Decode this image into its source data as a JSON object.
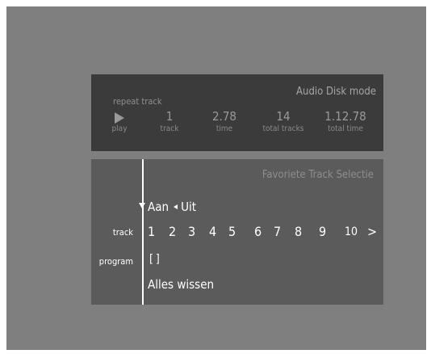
{
  "status": {
    "mode_title": "Audio Disk mode",
    "repeat_label": "repeat track",
    "play_label": "play",
    "stats": [
      {
        "value": "1",
        "label": "track"
      },
      {
        "value": "2.78",
        "label": "time"
      },
      {
        "value": "14",
        "label": "total tracks"
      },
      {
        "value": "1.12.78",
        "label": "total time"
      }
    ]
  },
  "favorites": {
    "title": "Favoriete Track Selectie",
    "toggle_on": "Aan",
    "toggle_off": "Uit",
    "track_label": "track",
    "program_label": "program",
    "tracks": [
      "1",
      "2",
      "3",
      "4",
      "5",
      "6",
      "7",
      "8",
      "9",
      "10"
    ],
    "next_glyph": ">",
    "program_value": "[]",
    "clear_all": "Alles wissen"
  }
}
